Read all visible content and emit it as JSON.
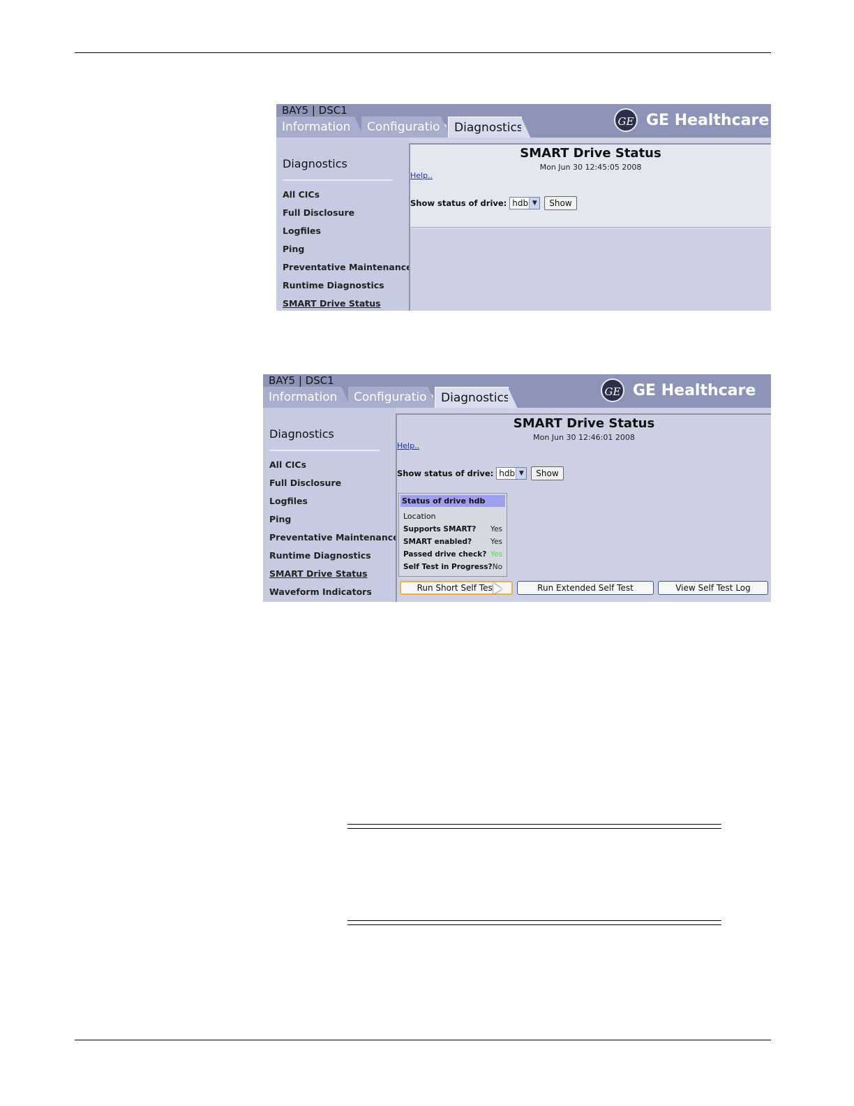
{
  "shots": [
    {
      "location": "BAY5 | DSC1",
      "tabs": [
        "Information",
        "Configuration",
        "Diagnostics"
      ],
      "brand": "GE Healthcare",
      "logo_text": "GE",
      "sidebar": {
        "title": "Diagnostics",
        "items": [
          "All CICs",
          "Full Disclosure",
          "Logfiles",
          "Ping",
          "Preventative Maintenance",
          "Runtime Diagnostics",
          "SMART Drive Status"
        ]
      },
      "main": {
        "title": "SMART Drive Status",
        "timestamp": "Mon Jun 30 12:45:05 2008",
        "help": "Help..",
        "show_label": "Show status of drive:",
        "drive": "hdb",
        "show_button": "Show"
      }
    },
    {
      "location": "BAY5 | DSC1",
      "tabs": [
        "Information",
        "Configuration",
        "Diagnostics"
      ],
      "brand": "GE Healthcare",
      "logo_text": "GE",
      "sidebar": {
        "title": "Diagnostics",
        "items": [
          "All CICs",
          "Full Disclosure",
          "Logfiles",
          "Ping",
          "Preventative Maintenance",
          "Runtime Diagnostics",
          "SMART Drive Status",
          "Waveform Indicators"
        ]
      },
      "main": {
        "title": "SMART Drive Status",
        "timestamp": "Mon Jun 30 12:46:01 2008",
        "help": "Help..",
        "show_label": "Show status of drive:",
        "drive": "hdb",
        "show_button": "Show",
        "status": {
          "header": "Status of drive hdb",
          "location_label": "Location",
          "rows": [
            {
              "label": "Supports SMART?",
              "value": "Yes"
            },
            {
              "label": "SMART enabled?",
              "value": "Yes"
            },
            {
              "label": "Passed drive check?",
              "value": "Yes"
            },
            {
              "label": "Self Test in Progress?",
              "value": "No"
            }
          ]
        },
        "actions": [
          "Run Short Self Test",
          "Run Extended Self Test",
          "View Self Test Log"
        ]
      }
    }
  ],
  "colors": {
    "header": "#8d94b8",
    "sidebar": "#c6cbe1",
    "status_header": "#9f9ff2",
    "status_ok": "#4de24d",
    "focus_border": "#e8b04a"
  }
}
